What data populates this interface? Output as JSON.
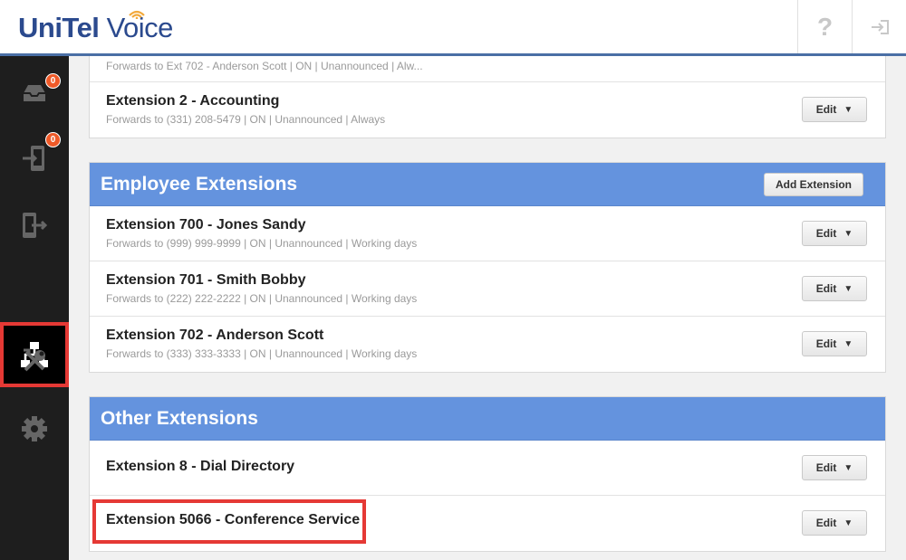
{
  "header": {
    "logo_primary": "UniTel",
    "logo_secondary": "Voice",
    "help_label": "?"
  },
  "sidebar": {
    "items": [
      {
        "icon": "inbox-icon",
        "badge": "0"
      },
      {
        "icon": "phone-forward-icon",
        "badge": "0"
      },
      {
        "icon": "phone-exit-icon"
      },
      {
        "icon": "sitemap-icon",
        "active": true
      },
      {
        "icon": "tools-icon"
      },
      {
        "icon": "gear-icon"
      }
    ]
  },
  "top_card": {
    "rows": [
      {
        "subtitle": "Forwards to Ext 702 - Anderson Scott | ON | Unannounced | Alw..."
      },
      {
        "title": "Extension 2 - Accounting",
        "subtitle": "Forwards to (331) 208-5479 | ON | Unannounced | Always",
        "edit_label": "Edit"
      }
    ]
  },
  "employee_section": {
    "title": "Employee Extensions",
    "add_label": "Add Extension",
    "rows": [
      {
        "title": "Extension 700 - Jones Sandy",
        "subtitle": "Forwards to (999) 999-9999 | ON | Unannounced | Working days",
        "edit_label": "Edit"
      },
      {
        "title": "Extension 701 - Smith Bobby",
        "subtitle": "Forwards to (222) 222-2222 | ON | Unannounced | Working days",
        "edit_label": "Edit"
      },
      {
        "title": "Extension 702 - Anderson Scott",
        "subtitle": "Forwards to (333) 333-3333 | ON | Unannounced | Working days",
        "edit_label": "Edit"
      }
    ]
  },
  "other_section": {
    "title": "Other Extensions",
    "rows": [
      {
        "title": "Extension 8 - Dial Directory",
        "edit_label": "Edit"
      },
      {
        "title": "Extension 5066 - Conference Service",
        "edit_label": "Edit"
      }
    ]
  },
  "colors": {
    "section_header": "#6493de",
    "sidebar": "#1e1e1e",
    "highlight": "#e53935",
    "badge": "#f05a28"
  }
}
